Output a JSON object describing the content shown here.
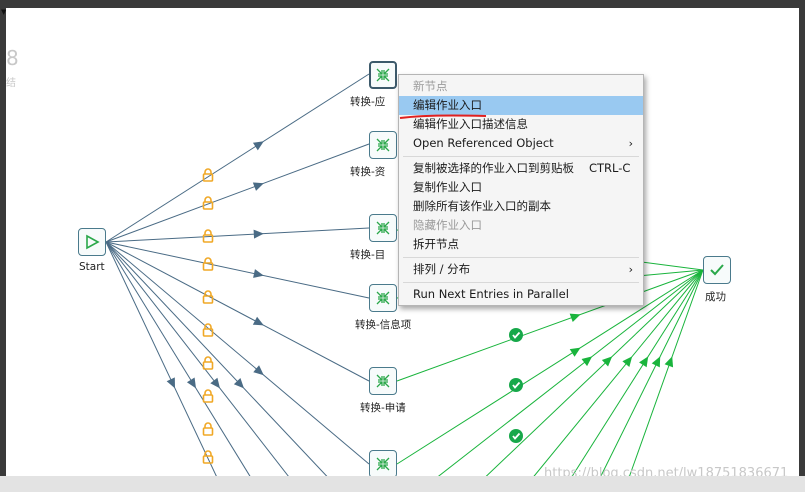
{
  "left_panel": {
    "number": "8",
    "char": "结"
  },
  "nodes": {
    "start": "Start",
    "trans_1": "转换-应",
    "trans_2": "转换-资",
    "trans_3": "转换-目",
    "trans_4": "转换-信息项",
    "trans_5": "转换-申请",
    "success": "成功"
  },
  "context_menu": {
    "header": "新节点",
    "items": [
      {
        "label": "编辑作业入口",
        "highlighted": true
      },
      {
        "label": "编辑作业入口描述信息"
      },
      {
        "label": "Open Referenced Object",
        "submenu": true
      },
      {
        "label": "复制被选择的作业入口到剪贴板",
        "shortcut": "CTRL-C"
      },
      {
        "label": "复制作业入口"
      },
      {
        "label": "删除所有该作业入口的副本"
      },
      {
        "label": "隐藏作业入口",
        "disabled": true
      },
      {
        "label": "拆开节点"
      },
      {
        "label": "排列 / 分布",
        "submenu": true
      },
      {
        "label": "Run Next Entries in Parallel"
      }
    ]
  },
  "watermark": "https://blog.csdn.net/lw18751836671",
  "colors": {
    "hop_line": "#4a6b85",
    "success_line": "#19b43c",
    "lock": "#f0a826",
    "menu_highlight": "#99c9f1",
    "underline": "#e02020"
  },
  "icons": {
    "start": "play-triangle-icon",
    "transform": "merge-arrows-icon",
    "success": "checkmark-icon",
    "lock": "lock-icon",
    "badge": "check-badge-icon"
  }
}
